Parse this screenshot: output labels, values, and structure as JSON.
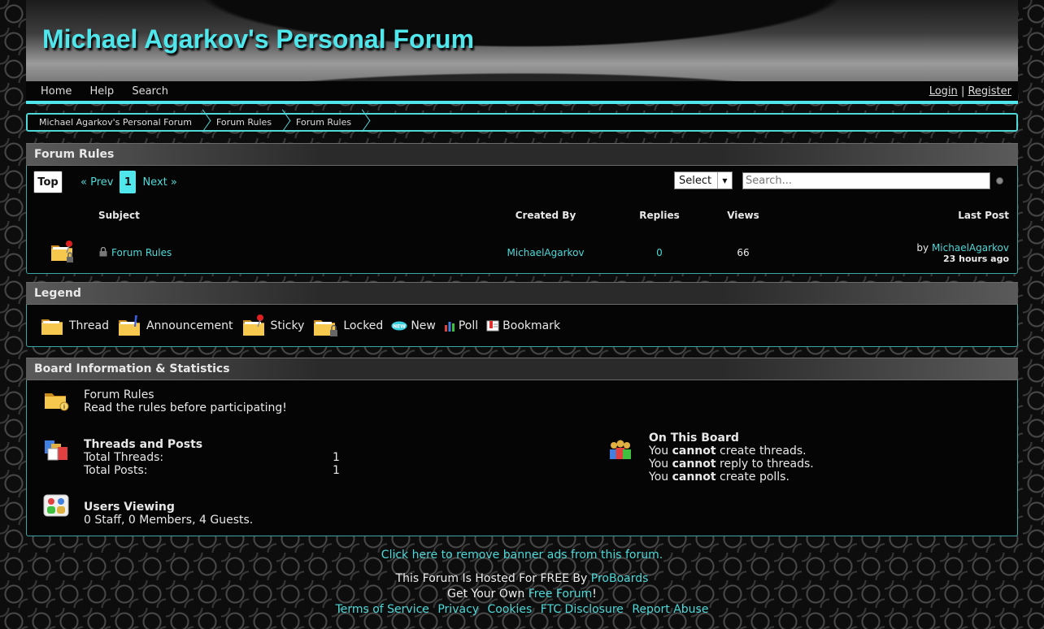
{
  "header": {
    "title": "Michael Agarkov's Personal Forum"
  },
  "nav": {
    "items": [
      "Home",
      "Help",
      "Search"
    ],
    "login": "Login",
    "sep": "|",
    "register": "Register"
  },
  "breadcrumb": [
    "Michael Agarkov's Personal Forum",
    "Forum Rules",
    "Forum Rules"
  ],
  "board": {
    "title": "Forum Rules",
    "top_label": "Top",
    "prev_label": "« Prev",
    "page": "1",
    "next_label": "Next »",
    "select_value": "Select",
    "search_placeholder": "Search...",
    "columns": {
      "subject": "Subject",
      "created_by": "Created By",
      "replies": "Replies",
      "views": "Views",
      "last_post": "Last Post"
    },
    "threads": [
      {
        "subject": "Forum Rules",
        "created_by": "MichaelAgarkov",
        "replies": "0",
        "views": "66",
        "last_by_prefix": "by",
        "last_by": "MichaelAgarkov",
        "last_time": "23 hours ago"
      }
    ]
  },
  "legend": {
    "title": "Legend",
    "items": [
      "Thread",
      "Announcement",
      "Sticky",
      "Locked",
      "New",
      "Poll",
      "Bookmark"
    ]
  },
  "stats": {
    "title": "Board Information & Statistics",
    "board_name": "Forum Rules",
    "board_desc": "Read the rules before participating!",
    "tp_title": "Threads and Posts",
    "total_threads_label": "Total Threads:",
    "total_threads": "1",
    "total_posts_label": "Total Posts:",
    "total_posts": "1",
    "users_title": "Users Viewing",
    "users_text": "0 Staff, 0 Members, 4 Guests.",
    "otb_title": "On This Board",
    "otb_lines": [
      {
        "pre": "You",
        "bold": "cannot",
        "post": "create threads."
      },
      {
        "pre": "You",
        "bold": "cannot",
        "post": "reply to threads."
      },
      {
        "pre": "You",
        "bold": "cannot",
        "post": "create polls."
      }
    ]
  },
  "footer": {
    "remove_ads": "Click here to remove banner ads from this forum.",
    "hosted_pre": "This Forum Is Hosted For FREE By",
    "hosted_link": "ProBoards",
    "own_pre": "Get Your Own",
    "own_link": "Free Forum",
    "own_post": "!",
    "links": [
      "Terms of Service",
      "Privacy",
      "Cookies",
      "FTC Disclosure",
      "Report Abuse"
    ]
  },
  "colors": {
    "accent": "#4fe6ec",
    "link": "#4fd8d8",
    "background": "#0d0d0d"
  }
}
